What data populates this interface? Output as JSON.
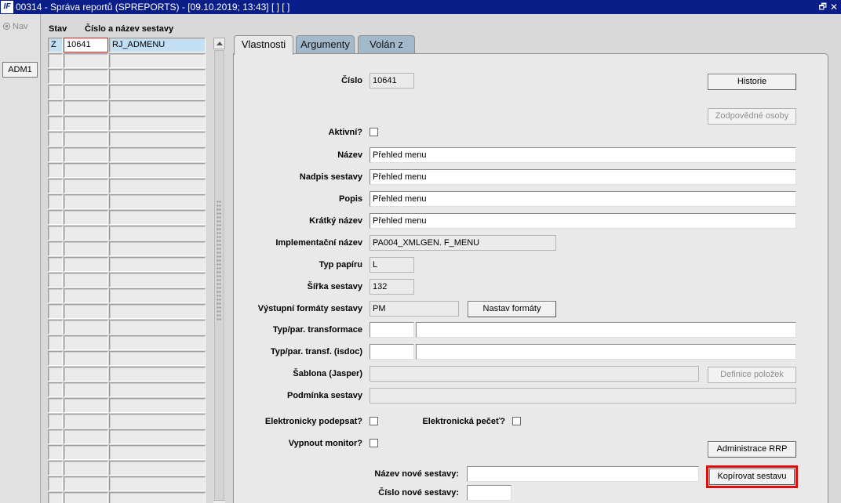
{
  "titlebar": {
    "logo": "IF",
    "title": "00314 - Správa reportů (SPREPORTS) - [09.10.2019; 13:43]  [ ]  [ ]",
    "restore_icon": "restore-window-icon",
    "close_icon": "close-icon",
    "restore_glyph": "🗗",
    "close_glyph": "✕"
  },
  "nav": {
    "label": "Nav",
    "button": "ADM1"
  },
  "grid": {
    "col_status": "Stav",
    "col_name": "Číslo a název sestavy",
    "rows": [
      {
        "status": "Z",
        "number": "10641",
        "name": "RJ_ADMENU",
        "selected": true
      },
      {
        "status": "",
        "number": "",
        "name": ""
      },
      {
        "status": "",
        "number": "",
        "name": ""
      },
      {
        "status": "",
        "number": "",
        "name": ""
      },
      {
        "status": "",
        "number": "",
        "name": ""
      },
      {
        "status": "",
        "number": "",
        "name": ""
      },
      {
        "status": "",
        "number": "",
        "name": ""
      },
      {
        "status": "",
        "number": "",
        "name": ""
      },
      {
        "status": "",
        "number": "",
        "name": ""
      },
      {
        "status": "",
        "number": "",
        "name": ""
      },
      {
        "status": "",
        "number": "",
        "name": ""
      },
      {
        "status": "",
        "number": "",
        "name": ""
      },
      {
        "status": "",
        "number": "",
        "name": ""
      },
      {
        "status": "",
        "number": "",
        "name": ""
      },
      {
        "status": "",
        "number": "",
        "name": ""
      },
      {
        "status": "",
        "number": "",
        "name": ""
      },
      {
        "status": "",
        "number": "",
        "name": ""
      },
      {
        "status": "",
        "number": "",
        "name": ""
      },
      {
        "status": "",
        "number": "",
        "name": ""
      },
      {
        "status": "",
        "number": "",
        "name": ""
      },
      {
        "status": "",
        "number": "",
        "name": ""
      },
      {
        "status": "",
        "number": "",
        "name": ""
      },
      {
        "status": "",
        "number": "",
        "name": ""
      },
      {
        "status": "",
        "number": "",
        "name": ""
      },
      {
        "status": "",
        "number": "",
        "name": ""
      },
      {
        "status": "",
        "number": "",
        "name": ""
      },
      {
        "status": "",
        "number": "",
        "name": ""
      },
      {
        "status": "",
        "number": "",
        "name": ""
      },
      {
        "status": "",
        "number": "",
        "name": ""
      },
      {
        "status": "",
        "number": "",
        "name": ""
      }
    ]
  },
  "tabs": [
    {
      "label": "Vlastnosti",
      "active": true
    },
    {
      "label": "Argumenty",
      "active": false
    },
    {
      "label": "Volán z",
      "active": false
    }
  ],
  "form": {
    "cislo_label": "Číslo",
    "cislo_value": "10641",
    "historie_button": "Historie",
    "zodpovedne_button": "Zodpovědné osoby",
    "aktivni_label": "Aktivní?",
    "nazev_label": "Název",
    "nazev_value": "Přehled menu",
    "nadpis_label": "Nadpis sestavy",
    "nadpis_value": "Přehled menu",
    "popis_label": "Popis",
    "popis_value": "Přehled menu",
    "kratky_label": "Krátký název",
    "kratky_value": "Přehled menu",
    "impl_label": "Implementační název",
    "impl_value": "PA004_XMLGEN. F_MENU",
    "typ_papiru_label": "Typ papíru",
    "typ_papiru_value": "L",
    "sirka_label": "Šířka sestavy",
    "sirka_value": "132",
    "formaty_label": "Výstupní formáty sestavy",
    "formaty_value": "PM",
    "nastav_formaty_button": "Nastav formáty",
    "transf_label": "Typ/par. transformace",
    "transf_isdoc_label": "Typ/par. transf. (isdoc)",
    "sablona_label": "Šablona (Jasper)",
    "definice_button": "Definice položek",
    "podminka_label": "Podmínka sestavy",
    "el_podpis_label": "Elektronicky podepsat?",
    "el_pecet_label": "Elektronická pečeť?",
    "vypnout_label": "Vypnout monitor?",
    "admin_rrp_button": "Administrace RRP",
    "nazev_nove_label": "Název nové sestavy:",
    "kopirovat_button": "Kopírovat sestavu",
    "cislo_nove_label": "Číslo nové sestavy:"
  }
}
